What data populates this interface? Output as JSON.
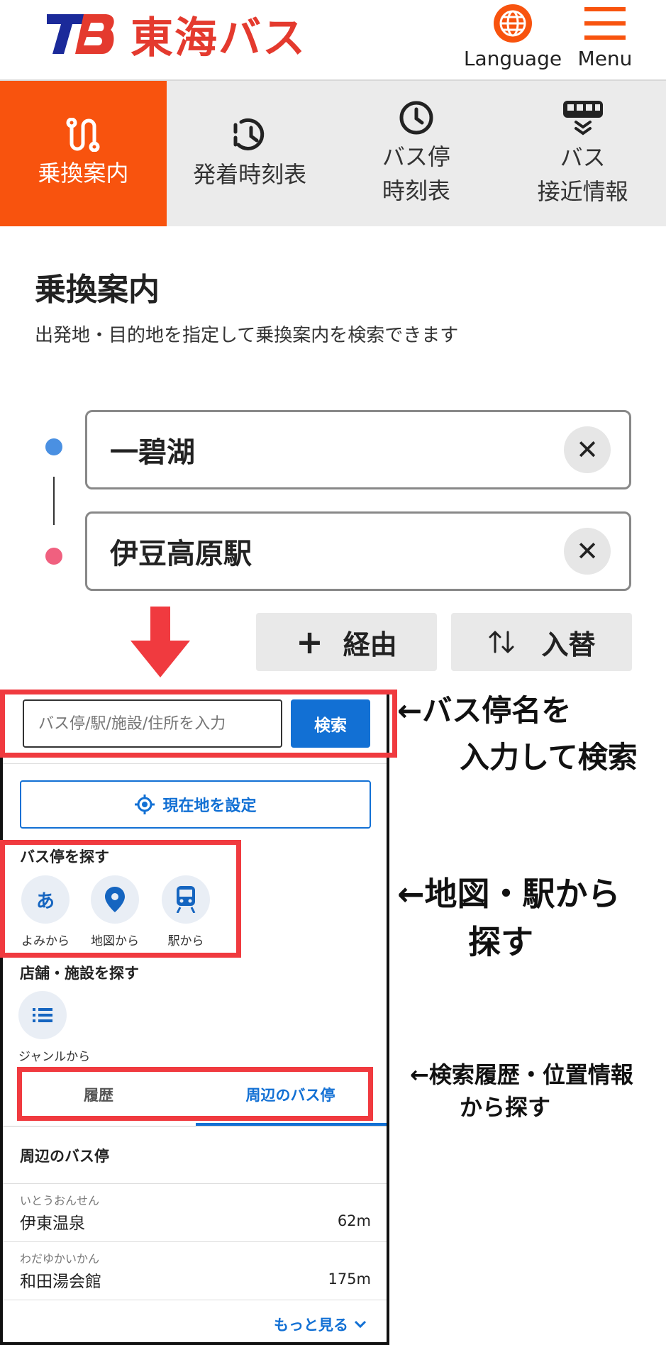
{
  "header": {
    "logo_text": "東海バス",
    "language_label": "Language",
    "menu_label": "Menu",
    "accent_color": "#f8530e"
  },
  "tabs": [
    {
      "line1": "乗換案内",
      "line2": "",
      "icon": "route-icon",
      "active": true
    },
    {
      "line1": "発着時刻表",
      "line2": "",
      "icon": "clock-history-icon",
      "active": false
    },
    {
      "line1": "バス停",
      "line2": "時刻表",
      "icon": "clock-icon",
      "active": false
    },
    {
      "line1": "バス",
      "line2": "接近情報",
      "icon": "bus-approach-icon",
      "active": false
    }
  ],
  "main": {
    "title": "乗換案内",
    "description": "出発地・目的地を指定して乗換案内を検索できます",
    "from_value": "一碧湖",
    "to_value": "伊豆高原駅",
    "clear_symbol": "✕",
    "via_label": "経由",
    "swap_label": "入替"
  },
  "panel": {
    "search_placeholder": "バス停/駅/施設/住所を入力",
    "search_button": "検索",
    "location_button": "現在地を設定",
    "stop_section_label": "バス停を探す",
    "stop_options": [
      {
        "glyph": "あ",
        "label": "よみから"
      },
      {
        "glyph": "",
        "label": "地図から"
      },
      {
        "glyph": "",
        "label": "駅から"
      }
    ],
    "facility_section_label": "店舗・施設を探す",
    "genre_label": "ジャンルから",
    "tab_history": "履歴",
    "tab_nearby": "周辺のバス停",
    "nearby_heading": "周辺のバス停",
    "nearby_stops": [
      {
        "kana": "いとうおんせん",
        "name": "伊東温泉",
        "distance": "62m"
      },
      {
        "kana": "わだゆかいかん",
        "name": "和田湯会館",
        "distance": "175m"
      }
    ],
    "more_label": "もっと見る"
  },
  "annotations": {
    "search_line1": "←バス停名を",
    "search_line2": "入力して検索",
    "map_line1": "←地図・駅から",
    "map_line2": "探す",
    "history_line1": "←検索履歴・位置情報",
    "history_line2": "から探す"
  },
  "colors": {
    "accent": "#f8530e",
    "link_blue": "#1270d4",
    "highlight_red": "#f03a3f",
    "from_dot": "#4a90e2",
    "to_dot": "#f0607f"
  }
}
